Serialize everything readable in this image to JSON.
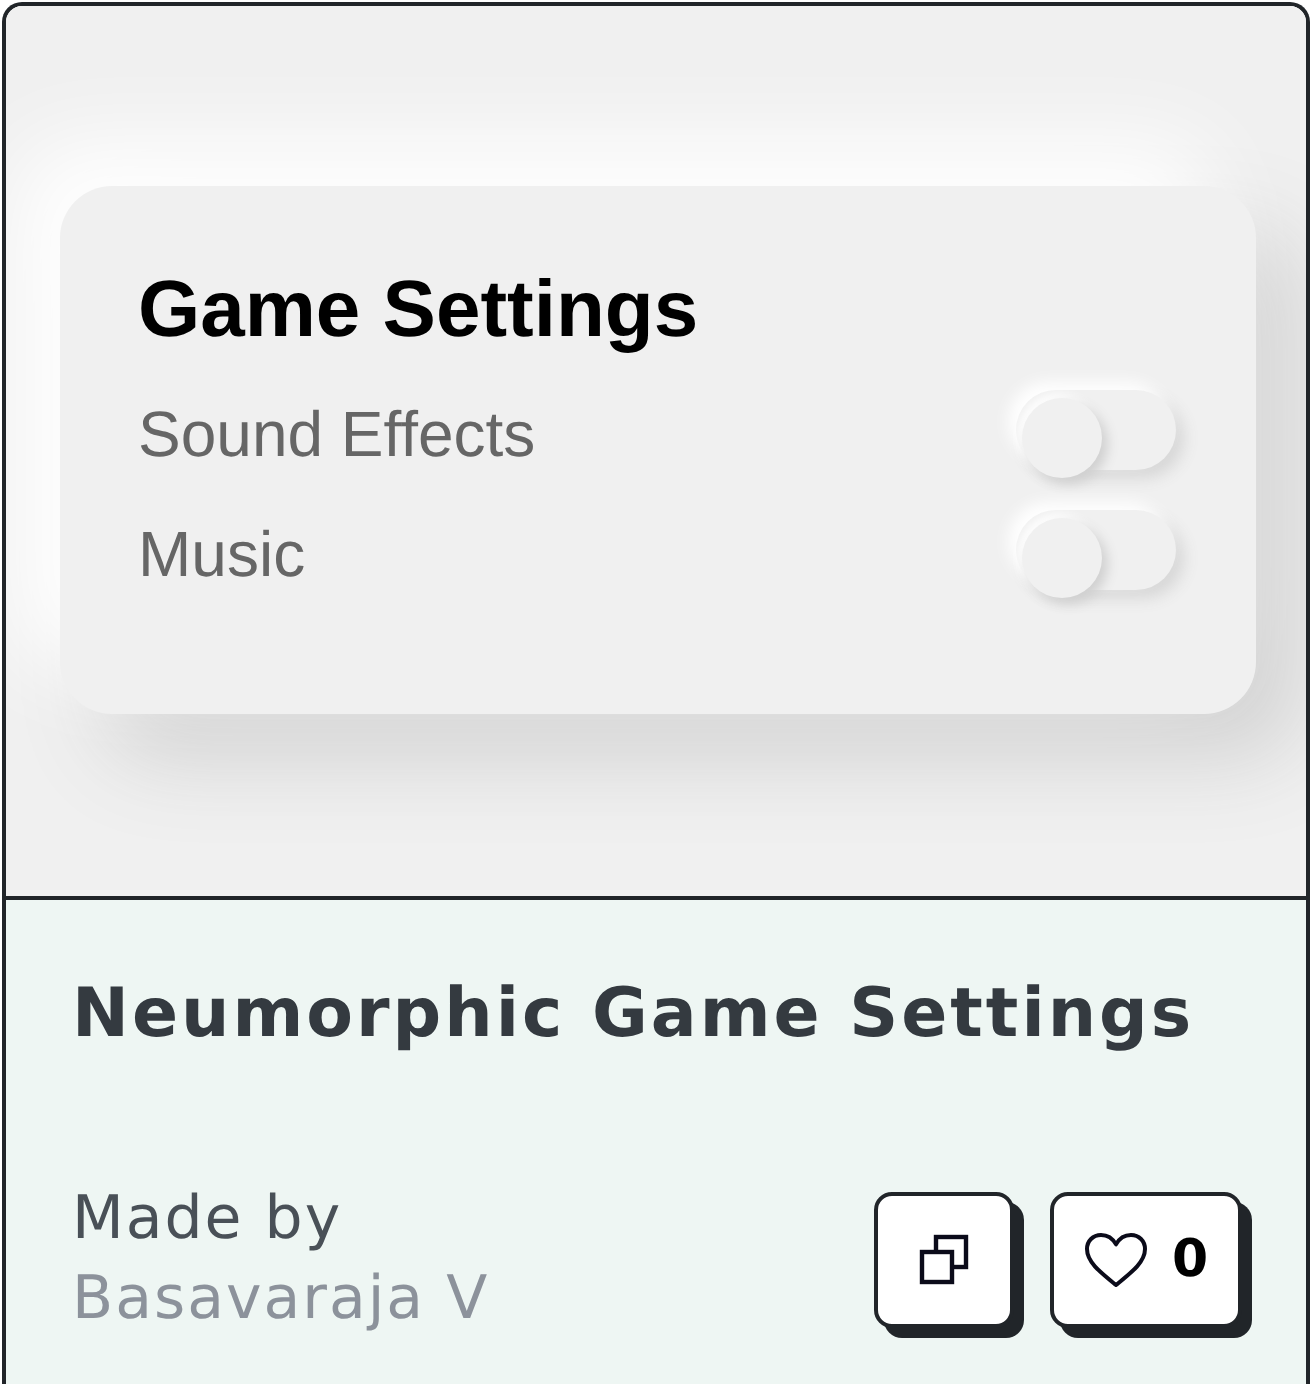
{
  "preview": {
    "title": "Game Settings",
    "settings": [
      {
        "label": "Sound Effects",
        "on": false
      },
      {
        "label": "Music",
        "on": false
      }
    ]
  },
  "footer": {
    "title": "Neumorphic Game Settings",
    "made_by_label": "Made by",
    "author": "Basavaraja V",
    "like_count": "0"
  }
}
